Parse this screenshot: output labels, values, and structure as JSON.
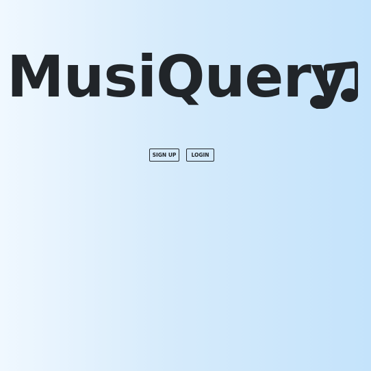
{
  "hero": {
    "title": "MusiQuery",
    "icon": "music-notes-icon"
  },
  "actions": {
    "signup_label": "SIGN UP",
    "login_label": "LOGIN"
  },
  "colors": {
    "text": "#212529",
    "background_start": "#f0f8ff",
    "background_end": "#c4e3fb"
  }
}
